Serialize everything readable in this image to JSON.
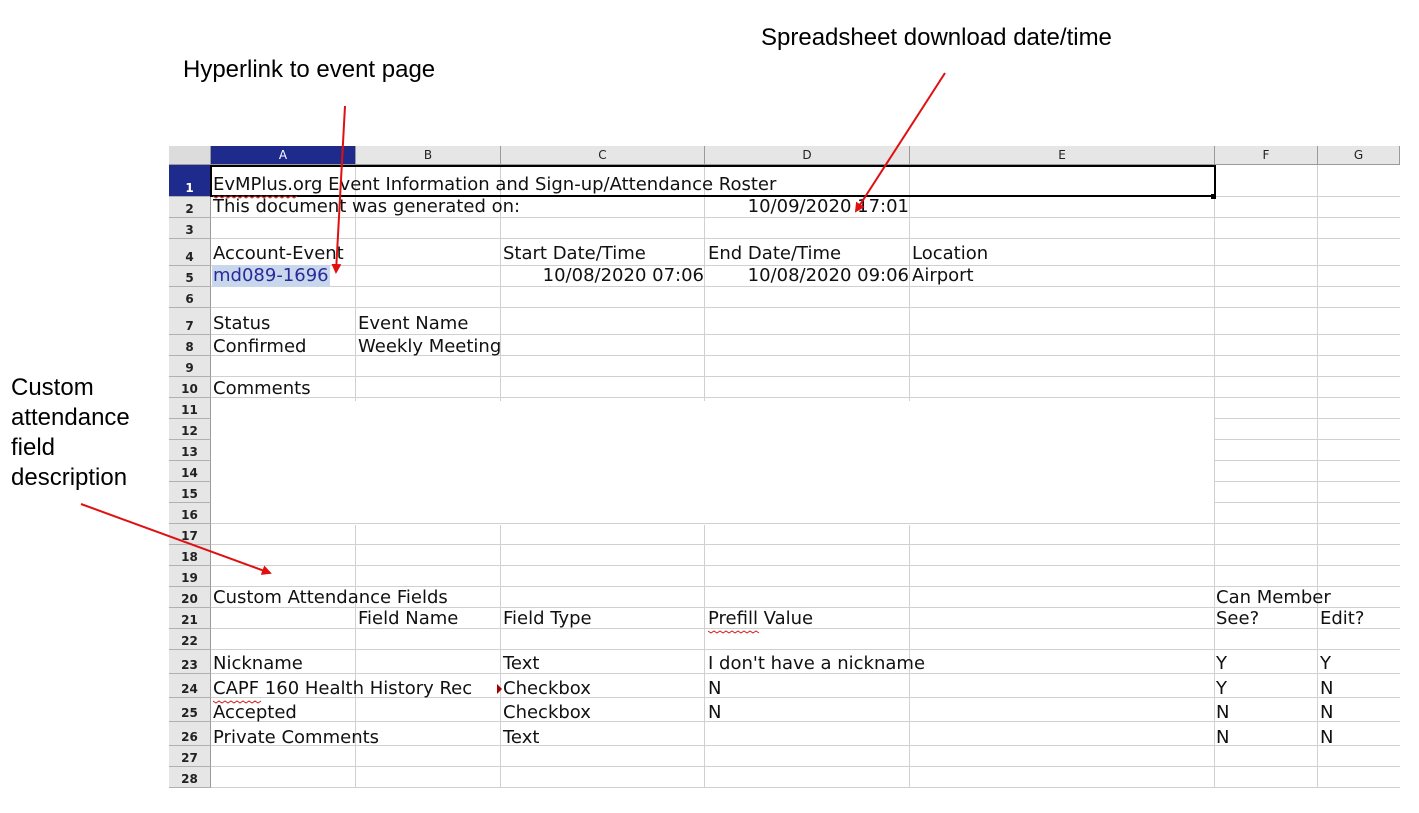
{
  "annotations": {
    "download": "Spreadsheet download date/time",
    "hyperlink": "Hyperlink to event page",
    "custom": "Custom attendance field description"
  },
  "sheet": {
    "columns": [
      "A",
      "B",
      "C",
      "D",
      "E",
      "F",
      "G"
    ],
    "selected_column": "A",
    "selected_row": 1,
    "rows": [
      "1",
      "2",
      "3",
      "4",
      "5",
      "6",
      "7",
      "8",
      "9",
      "10",
      "11",
      "12",
      "13",
      "14",
      "15",
      "16",
      "17",
      "18",
      "19",
      "20",
      "21",
      "22",
      "23",
      "24",
      "25",
      "26",
      "27",
      "28"
    ],
    "cells": {
      "r1": "EvMPlus.org Event Information and Sign-up/Attendance Roster",
      "r2_label": "This document was generated on:",
      "r2_value": "10/09/2020 17:01",
      "r4": {
        "account_event": "Account-Event",
        "start": "Start Date/Time",
        "end": "End Date/Time",
        "location": "Location"
      },
      "r5": {
        "event_link": "md089-1696",
        "start": "10/08/2020 07:06",
        "end": "10/08/2020 09:06",
        "location": "Airport"
      },
      "r7": {
        "status": "Status",
        "event_name": "Event Name"
      },
      "r8": {
        "status": "Confirmed",
        "event_name": "Weekly Meeting"
      },
      "r10": "Comments",
      "r20": {
        "title": "Custom Attendance Fields",
        "can_member": "Can Member"
      },
      "r21": {
        "field_name": "Field Name",
        "field_type": "Field Type",
        "prefill": "Prefill Value",
        "see": "See?",
        "edit": "Edit?"
      },
      "fields": [
        {
          "name": "Nickname",
          "type": "Text",
          "prefill": "I don't have a nickname",
          "see": "Y",
          "edit": "Y"
        },
        {
          "name": "CAPF 160 Health History Rec",
          "type": "Checkbox",
          "prefill": "N",
          "see": "Y",
          "edit": "N"
        },
        {
          "name": "Accepted",
          "type": "Checkbox",
          "prefill": "N",
          "see": "N",
          "edit": "N"
        },
        {
          "name": "Private Comments",
          "type": "Text",
          "prefill": "",
          "see": "N",
          "edit": "N"
        }
      ]
    }
  },
  "colors": {
    "header_selected": "#1f2b8c",
    "link": "#2a2a9a",
    "arrow": "#e01010"
  }
}
